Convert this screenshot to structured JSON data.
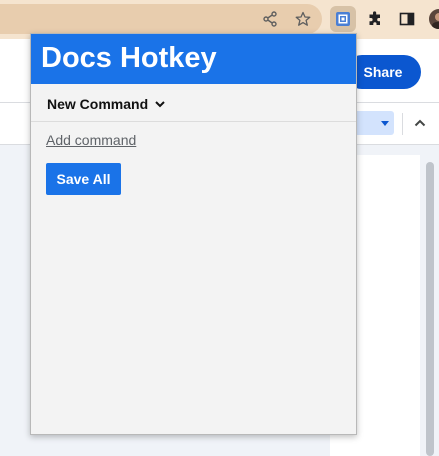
{
  "browser": {
    "toolbar_icons": [
      "share-icon",
      "star-icon",
      "docs-hotkey-extension-icon",
      "puzzle-icon",
      "side-panel-icon",
      "profile-avatar"
    ]
  },
  "docs": {
    "share_label": "Share"
  },
  "popup": {
    "title": "Docs Hotkey",
    "command_toggle_label": "New Command",
    "add_command_label": "Add command",
    "save_all_label": "Save All"
  },
  "colors": {
    "popup_header": "#1a73e8",
    "save_button": "#1a73e8",
    "share_button": "#0b57d0",
    "toolbar": "#f5e4cf"
  }
}
